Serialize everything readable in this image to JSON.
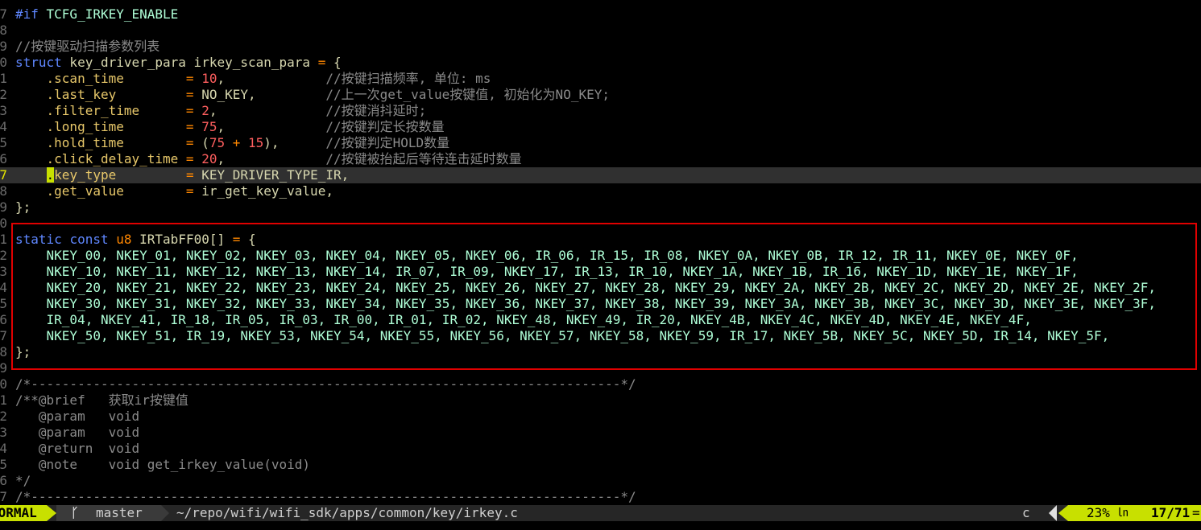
{
  "editor": {
    "lines": [
      {
        "n": "7",
        "segments": [
          {
            "t": "#if ",
            "c": "pre"
          },
          {
            "t": "TCFG_IRKEY_ENABLE",
            "c": "cst"
          }
        ]
      },
      {
        "n": "8",
        "segments": []
      },
      {
        "n": "9",
        "segments": [
          {
            "t": "//按键驱动扫描参数列表",
            "c": "cm"
          }
        ]
      },
      {
        "n": "0",
        "segments": [
          {
            "t": "struct",
            "c": "kw"
          },
          {
            "t": " key_driver_para irkey_scan_para ",
            "c": "id"
          },
          {
            "t": "=",
            "c": "op"
          },
          {
            "t": " {",
            "c": "id"
          }
        ]
      },
      {
        "n": "1",
        "segments": [
          {
            "t": "    .scan_time        ",
            "c": "mem"
          },
          {
            "t": "=",
            "c": "op"
          },
          {
            "t": " ",
            "c": "id"
          },
          {
            "t": "10",
            "c": "num"
          },
          {
            "t": ",             ",
            "c": "id"
          },
          {
            "t": "//按键扫描频率, 单位: ms",
            "c": "cm"
          }
        ]
      },
      {
        "n": "2",
        "segments": [
          {
            "t": "    .last_key         ",
            "c": "mem"
          },
          {
            "t": "=",
            "c": "op"
          },
          {
            "t": " NO_KEY,         ",
            "c": "id"
          },
          {
            "t": "//上一次get_value按键值, 初始化为NO_KEY;",
            "c": "cm"
          }
        ]
      },
      {
        "n": "3",
        "segments": [
          {
            "t": "    .filter_time      ",
            "c": "mem"
          },
          {
            "t": "=",
            "c": "op"
          },
          {
            "t": " ",
            "c": "id"
          },
          {
            "t": "2",
            "c": "num"
          },
          {
            "t": ",              ",
            "c": "id"
          },
          {
            "t": "//按键消抖延时;",
            "c": "cm"
          }
        ]
      },
      {
        "n": "4",
        "segments": [
          {
            "t": "    .long_time        ",
            "c": "mem"
          },
          {
            "t": "=",
            "c": "op"
          },
          {
            "t": " ",
            "c": "id"
          },
          {
            "t": "75",
            "c": "num"
          },
          {
            "t": ",             ",
            "c": "id"
          },
          {
            "t": "//按键判定长按数量",
            "c": "cm"
          }
        ]
      },
      {
        "n": "5",
        "segments": [
          {
            "t": "    .hold_time        ",
            "c": "mem"
          },
          {
            "t": "=",
            "c": "op"
          },
          {
            "t": " (",
            "c": "id"
          },
          {
            "t": "75",
            "c": "num"
          },
          {
            "t": " ",
            "c": "id"
          },
          {
            "t": "+",
            "c": "op"
          },
          {
            "t": " ",
            "c": "id"
          },
          {
            "t": "15",
            "c": "num"
          },
          {
            "t": "),      ",
            "c": "id"
          },
          {
            "t": "//按键判定HOLD数量",
            "c": "cm"
          }
        ]
      },
      {
        "n": "6",
        "segments": [
          {
            "t": "    .click_delay_time ",
            "c": "mem"
          },
          {
            "t": "=",
            "c": "op"
          },
          {
            "t": " ",
            "c": "id"
          },
          {
            "t": "20",
            "c": "num"
          },
          {
            "t": ",             ",
            "c": "id"
          },
          {
            "t": "//按键被抬起后等待连击延时数量",
            "c": "cm"
          }
        ]
      },
      {
        "n": "7",
        "current": true,
        "segments": [
          {
            "t": "    ",
            "c": "id"
          },
          {
            "t": ".",
            "c": "cursor"
          },
          {
            "t": "key_type         ",
            "c": "mem"
          },
          {
            "t": "=",
            "c": "op"
          },
          {
            "t": " KEY_DRIVER_TYPE_IR,",
            "c": "id"
          }
        ]
      },
      {
        "n": "8",
        "segments": [
          {
            "t": "    .get_value        ",
            "c": "mem"
          },
          {
            "t": "=",
            "c": "op"
          },
          {
            "t": " ir_get_key_value,",
            "c": "id"
          }
        ]
      },
      {
        "n": "9",
        "segments": [
          {
            "t": "};",
            "c": "id"
          }
        ]
      },
      {
        "n": "0",
        "segments": []
      },
      {
        "n": "1",
        "segments": [
          {
            "t": "static",
            "c": "kw"
          },
          {
            "t": " ",
            "c": "id"
          },
          {
            "t": "const",
            "c": "kw"
          },
          {
            "t": " ",
            "c": "id"
          },
          {
            "t": "u8",
            "c": "ty"
          },
          {
            "t": " IRTabFF00[] ",
            "c": "id"
          },
          {
            "t": "=",
            "c": "op"
          },
          {
            "t": " {",
            "c": "id"
          }
        ]
      },
      {
        "n": "2",
        "segments": [
          {
            "t": "    NKEY_00, NKEY_01, NKEY_02, NKEY_03, NKEY_04, NKEY_05, NKEY_06, IR_06, IR_15, IR_08, NKEY_0A, NKEY_0B, IR_12, IR_11, NKEY_0E, NKEY_0F,",
            "c": "cst"
          }
        ]
      },
      {
        "n": "3",
        "segments": [
          {
            "t": "    NKEY_10, NKEY_11, NKEY_12, NKEY_13, NKEY_14, IR_07, IR_09, NKEY_17, IR_13, IR_10, NKEY_1A, NKEY_1B, IR_16, NKEY_1D, NKEY_1E, NKEY_1F,",
            "c": "cst"
          }
        ]
      },
      {
        "n": "4",
        "segments": [
          {
            "t": "    NKEY_20, NKEY_21, NKEY_22, NKEY_23, NKEY_24, NKEY_25, NKEY_26, NKEY_27, NKEY_28, NKEY_29, NKEY_2A, NKEY_2B, NKEY_2C, NKEY_2D, NKEY_2E, NKEY_2F,",
            "c": "cst"
          }
        ]
      },
      {
        "n": "5",
        "segments": [
          {
            "t": "    NKEY_30, NKEY_31, NKEY_32, NKEY_33, NKEY_34, NKEY_35, NKEY_36, NKEY_37, NKEY_38, NKEY_39, NKEY_3A, NKEY_3B, NKEY_3C, NKEY_3D, NKEY_3E, NKEY_3F,",
            "c": "cst"
          }
        ]
      },
      {
        "n": "6",
        "segments": [
          {
            "t": "    IR_04, NKEY_41, IR_18, IR_05, IR_03, IR_00, IR_01, IR_02, NKEY_48, NKEY_49, IR_20, NKEY_4B, NKEY_4C, NKEY_4D, NKEY_4E, NKEY_4F,",
            "c": "cst"
          }
        ]
      },
      {
        "n": "7",
        "segments": [
          {
            "t": "    NKEY_50, NKEY_51, IR_19, NKEY_53, NKEY_54, NKEY_55, NKEY_56, NKEY_57, NKEY_58, NKEY_59, IR_17, NKEY_5B, NKEY_5C, NKEY_5D, IR_14, NKEY_5F,",
            "c": "cst"
          }
        ]
      },
      {
        "n": "8",
        "segments": [
          {
            "t": "};",
            "c": "id"
          }
        ]
      },
      {
        "n": "9",
        "segments": []
      },
      {
        "n": "0",
        "segments": [
          {
            "t": "/*----------------------------------------------------------------------------*/",
            "c": "cm"
          }
        ]
      },
      {
        "n": "1",
        "segments": [
          {
            "t": "/**@brief   获取ir按键值",
            "c": "cm"
          }
        ]
      },
      {
        "n": "2",
        "segments": [
          {
            "t": "   @param   void",
            "c": "cm"
          }
        ]
      },
      {
        "n": "3",
        "segments": [
          {
            "t": "   @param   void",
            "c": "cm"
          }
        ]
      },
      {
        "n": "4",
        "segments": [
          {
            "t": "   @return  void",
            "c": "cm"
          }
        ]
      },
      {
        "n": "5",
        "segments": [
          {
            "t": "   @note    void get_irkey_value(void)",
            "c": "cm"
          }
        ]
      },
      {
        "n": "6",
        "segments": [
          {
            "t": "*/",
            "c": "cm"
          }
        ]
      },
      {
        "n": "7",
        "segments": [
          {
            "t": "/*----------------------------------------------------------------------------*/",
            "c": "cm"
          }
        ]
      }
    ]
  },
  "statusline": {
    "mode": "NORMAL",
    "branch_icon": "ᚴ",
    "branch": "master",
    "file_path": "~/repo/wifi/wifi_sdk/apps/common/key/irkey.c",
    "filetype": "c",
    "percent": "23%",
    "ln_icon": "㏑",
    "position": "17/71",
    "position_trail": "="
  },
  "colors": {
    "background": "#000000",
    "keyword": "#5f87ff",
    "number": "#ff5f5f",
    "comment": "#8a8a8a",
    "constant": "#afffd7",
    "mode_accent": "#c8e000",
    "selection_border": "#e00000"
  }
}
